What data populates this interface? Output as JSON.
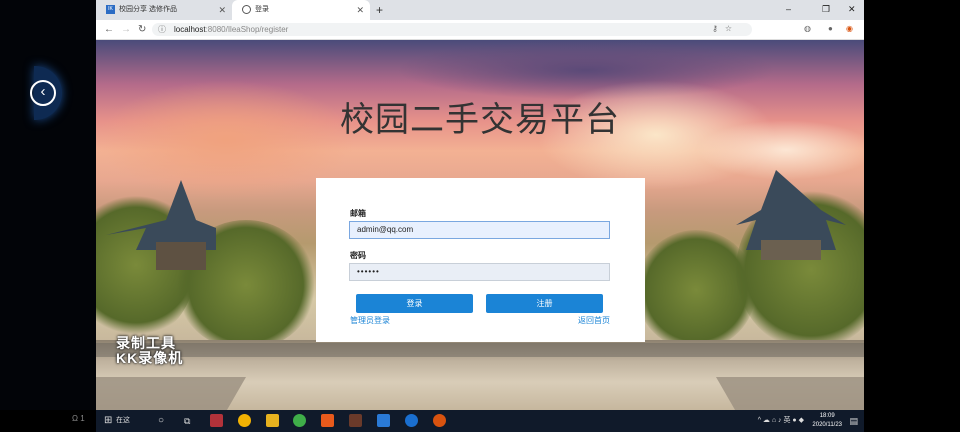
{
  "browser": {
    "tabs": [
      {
        "favicon_text": "IK",
        "title": "校园分享 选修作品",
        "active": false
      },
      {
        "title": "登录",
        "active": true
      }
    ],
    "new_tab_label": "+",
    "window_controls": {
      "minimize": "–",
      "maximize": "❐",
      "close": "✕"
    },
    "url": {
      "host": "localhost",
      "path": ":8080/IleaShop/register"
    }
  },
  "page": {
    "title": "校园二手交易平台",
    "watermark": {
      "line1": "录制工具",
      "line2": "KK录像机"
    },
    "form": {
      "email_label": "邮箱",
      "email_value": "admin@qq.com",
      "password_label": "密码",
      "password_value": "••••••",
      "login_button": "登录",
      "register_button": "注册",
      "admin_login_link": "管理员登录",
      "back_home_link": "返回首页"
    }
  },
  "taskbar": {
    "search_text": "在这",
    "tray_text": "英",
    "clock_time": "18:09",
    "clock_date": "2020/11/23"
  },
  "left_panel": {
    "icon": "chevron-left-icon"
  },
  "bottom_left_text": "Ω  1"
}
